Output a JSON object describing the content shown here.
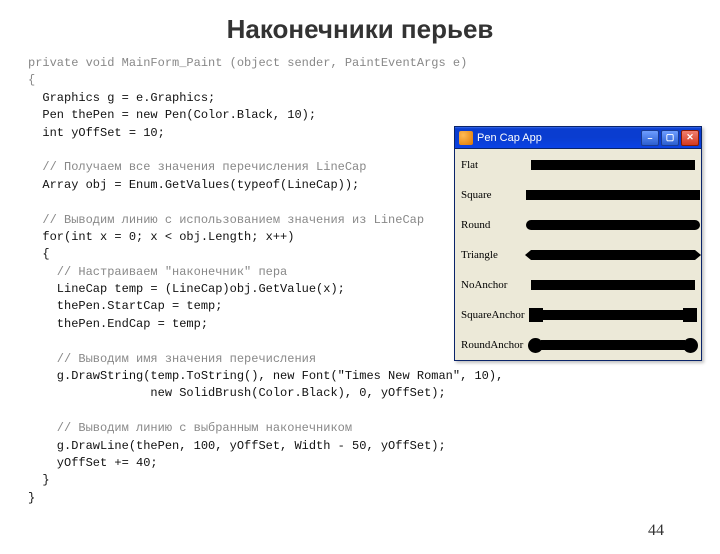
{
  "title": "Наконечники перьев",
  "page_number": "44",
  "code": {
    "l01": "private void MainForm_Paint (object sender, PaintEventArgs e)",
    "l02": "{",
    "l03": "  Graphics g = e.Graphics;",
    "l04": "  Pen thePen = new Pen(Color.Black, 10);",
    "l05": "  int yOffSet = 10;",
    "l06": "",
    "l07": "  // Получаем все значения перечисления LineCap",
    "l08": "  Array obj = Enum.GetValues(typeof(LineCap));",
    "l09": "",
    "l10": "  // Выводим линию с использованием значения из LineCap",
    "l11": "  for(int x = 0; x < obj.Length; x++)",
    "l12": "  {",
    "l13": "    // Настраиваем \"наконечник\" пера",
    "l14": "    LineCap temp = (LineCap)obj.GetValue(x);",
    "l15": "    thePen.StartCap = temp;",
    "l16": "    thePen.EndCap = temp;",
    "l17": "",
    "l18": "    // Выводим имя значения перечисления",
    "l19": "    g.DrawString(temp.ToString(), new Font(\"Times New Roman\", 10),",
    "l20": "                 new SolidBrush(Color.Black), 0, yOffSet);",
    "l21": "",
    "l22": "    // Выводим линию с выбранным наконечником",
    "l23": "    g.DrawLine(thePen, 100, yOffSet, Width - 50, yOffSet);",
    "l24": "    yOffSet += 40;",
    "l25": "  }",
    "l26": "}"
  },
  "app": {
    "title": "Pen Cap App",
    "caps": [
      "Flat",
      "Square",
      "Round",
      "Triangle",
      "NoAnchor",
      "SquareAnchor",
      "RoundAnchor"
    ]
  }
}
